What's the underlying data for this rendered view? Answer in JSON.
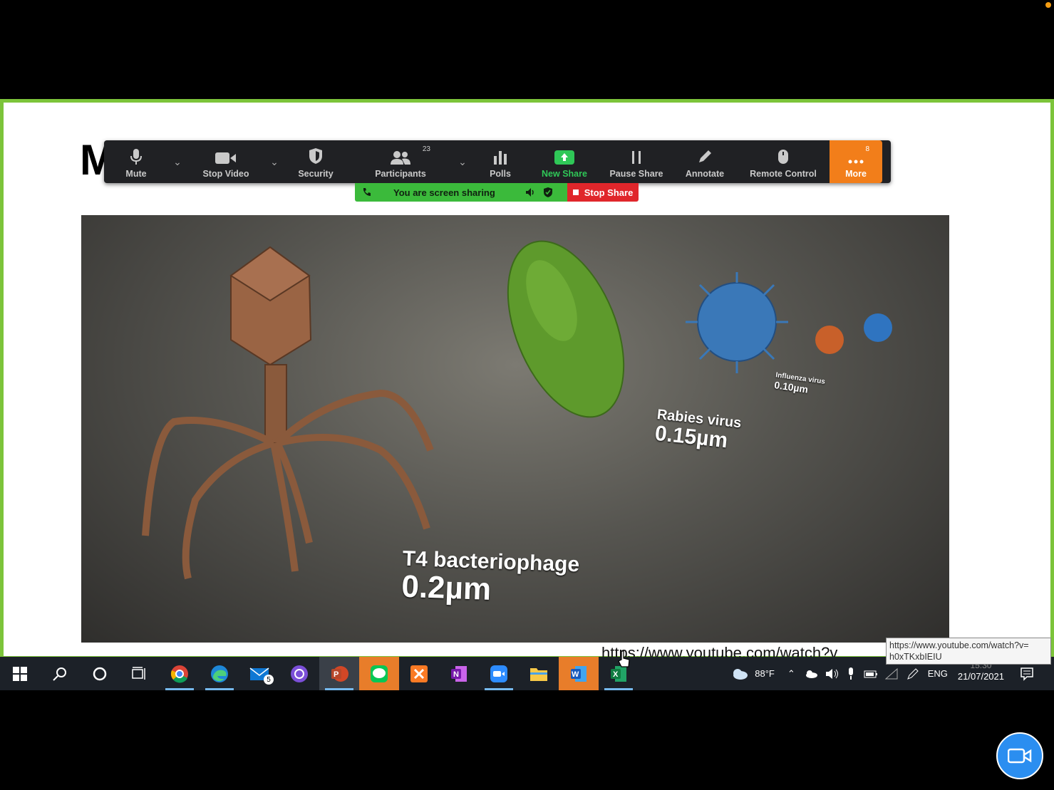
{
  "slide": {
    "title_visible": "M"
  },
  "toolbar": {
    "mute": "Mute",
    "stop_video": "Stop Video",
    "security": "Security",
    "participants": "Participants",
    "participants_count": "23",
    "polls": "Polls",
    "new_share": "New Share",
    "pause_share": "Pause Share",
    "annotate": "Annotate",
    "remote_control": "Remote Control",
    "more": "More",
    "more_count": "8"
  },
  "share_banner": {
    "status": "You are screen sharing",
    "stop": "Stop Share"
  },
  "image_labels": {
    "t4_name": "T4 bacteriophage",
    "t4_size": "0.2µm",
    "rabies_name": "Rabies virus",
    "rabies_size": "0.15µm",
    "influenza_name": "Influenza virus",
    "influenza_size": "0.10µm"
  },
  "url_text": "https://www.youtube.com/watch?v",
  "tooltip": {
    "line1": "https://www.youtube.com/watch?v=",
    "line2": "h0xTKxbIEIU"
  },
  "taskbar": {
    "mail_badge": "5",
    "weather": "88°F",
    "language": "ENG",
    "time": "15:30",
    "date": "21/07/2021"
  },
  "colors": {
    "share_border": "#7cc43a",
    "more_button": "#f27e1a",
    "stop_share": "#e0262b",
    "zoom_blue": "#2b8ef0"
  }
}
